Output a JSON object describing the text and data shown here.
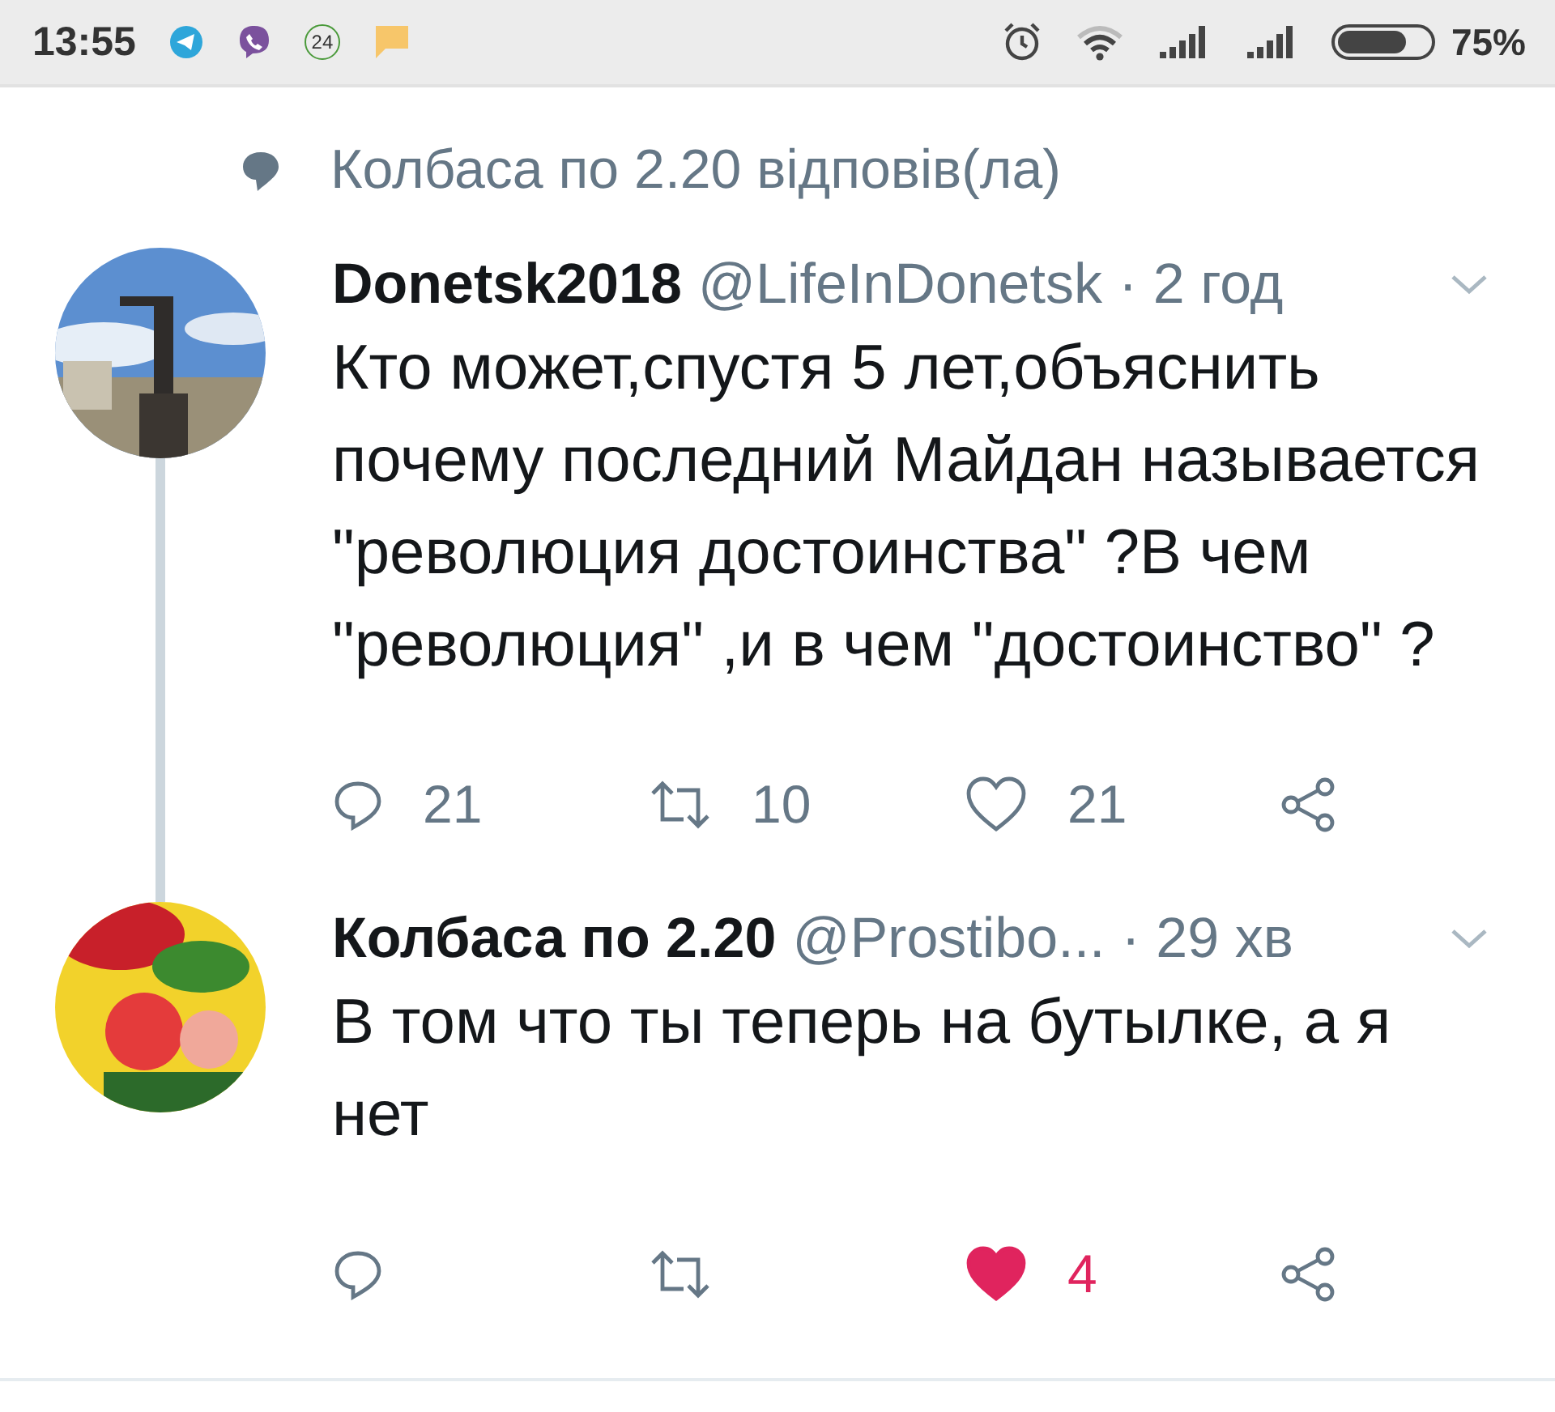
{
  "status_bar": {
    "time": "13:55",
    "notification_badge": "24",
    "battery": "75%"
  },
  "reply_context": "Колбаса по 2.20 відповів(ла)",
  "tweets": [
    {
      "name": "Donetsk2018",
      "handle": "@LifeInDonetsk",
      "time": "· 2 год",
      "text": "Кто может,спустя 5 лет,объяснить почему последний Майдан называется \"революция достоинства\" ?В чем \"революция\" ,и в чем \"достоинство\" ?",
      "replies": "21",
      "retweets": "10",
      "likes": "21",
      "liked": false
    },
    {
      "name": "Колбаса по 2.20",
      "handle": "@Prostibo...",
      "time": "· 29 хв",
      "text": "В том что ты теперь на бутылке, а я нет",
      "likes": "4",
      "liked": true
    }
  ]
}
